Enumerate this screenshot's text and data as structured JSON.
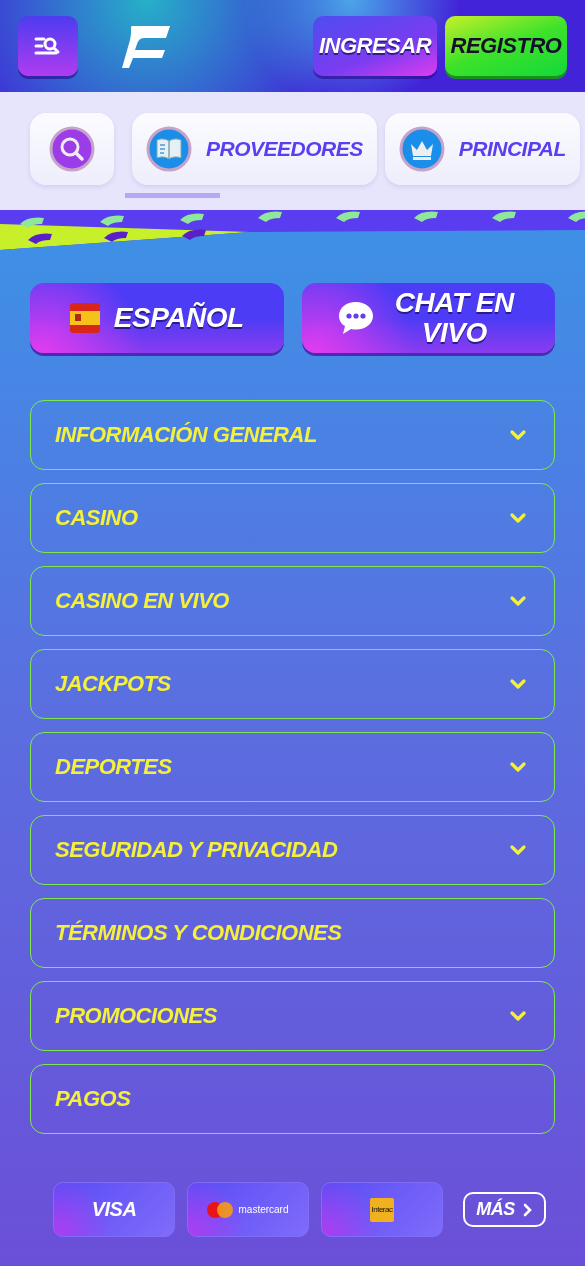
{
  "header": {
    "login_button": "INGRESAR",
    "register_button": "REGISTRO"
  },
  "categories": [
    {
      "kind": "search"
    },
    {
      "kind": "book",
      "label": "PROVEEDORES"
    },
    {
      "kind": "crown",
      "label": "PRINCIPAL"
    }
  ],
  "actions": [
    {
      "kind": "language",
      "label": "ESPAÑOL"
    },
    {
      "kind": "chat",
      "label": "CHAT EN VIVO"
    }
  ],
  "menu": [
    {
      "label": "INFORMACIÓN GENERAL",
      "expandable": true
    },
    {
      "label": "CASINO",
      "expandable": true
    },
    {
      "label": "CASINO EN VIVO",
      "expandable": true
    },
    {
      "label": "JACKPOTS",
      "expandable": true
    },
    {
      "label": "DEPORTES",
      "expandable": true
    },
    {
      "label": "SEGURIDAD Y PRIVACIDAD",
      "expandable": true
    },
    {
      "label": "TÉRMINOS Y CONDICIONES",
      "expandable": false
    },
    {
      "label": "PROMOCIONES",
      "expandable": true
    },
    {
      "label": "PAGOS",
      "expandable": false
    }
  ],
  "payments": [
    {
      "kind": "visa",
      "label": "VISA"
    },
    {
      "kind": "mastercard",
      "label": "mastercard"
    },
    {
      "kind": "interac",
      "label": "Interac"
    }
  ],
  "more_button": "MÁS"
}
